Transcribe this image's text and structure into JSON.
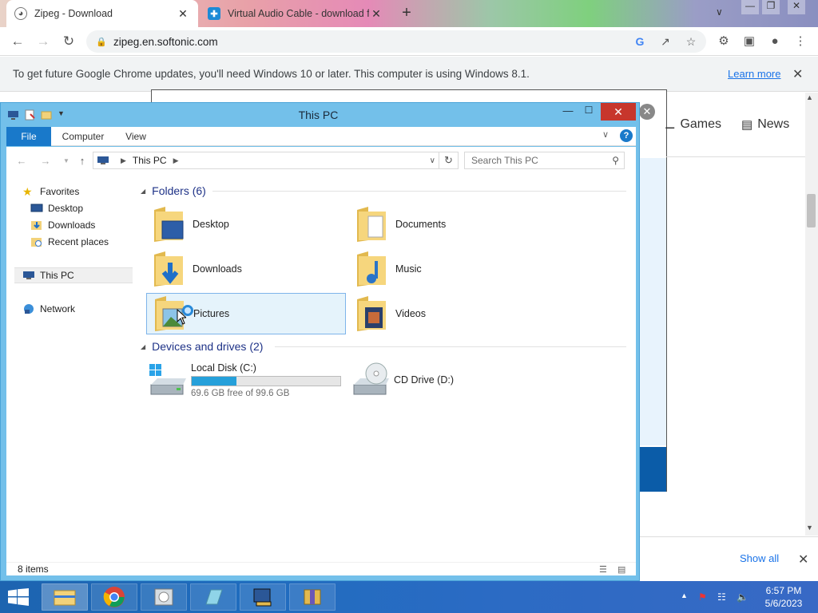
{
  "browser": {
    "tabs": [
      {
        "title": "Zipeg - Download",
        "favicon": "softonic-icon",
        "active": true
      },
      {
        "title": "Virtual Audio Cable - download f",
        "favicon": "vac-icon",
        "active": false
      }
    ],
    "new_tab": "+",
    "url": "zipeg.en.softonic.com",
    "infobar": {
      "message": "To get future Google Chrome updates, you'll need Windows 10 or later. This computer is using Windows 8.1.",
      "learn_more": "Learn more"
    }
  },
  "page": {
    "nav_games": "Games",
    "nav_news": "News",
    "show_all": "Show all"
  },
  "explorer": {
    "title": "This PC",
    "ribbon_tabs": [
      "File",
      "Computer",
      "View"
    ],
    "address": {
      "location": "This PC"
    },
    "search_placeholder": "Search This PC",
    "nav": {
      "favorites": "Favorites",
      "desktop": "Desktop",
      "downloads": "Downloads",
      "recent": "Recent places",
      "this_pc": "This PC",
      "network": "Network"
    },
    "folders_header": "Folders (6)",
    "folders": [
      {
        "name": "Desktop",
        "icon": "desktop-folder-icon"
      },
      {
        "name": "Documents",
        "icon": "documents-folder-icon"
      },
      {
        "name": "Downloads",
        "icon": "downloads-folder-icon"
      },
      {
        "name": "Music",
        "icon": "music-folder-icon"
      },
      {
        "name": "Pictures",
        "icon": "pictures-folder-icon",
        "selected": true
      },
      {
        "name": "Videos",
        "icon": "videos-folder-icon"
      }
    ],
    "devices_header": "Devices and drives (2)",
    "drives": [
      {
        "name": "Local Disk (C:)",
        "free": "69.6 GB free of 99.6 GB",
        "used_fraction": 0.3
      },
      {
        "name": "CD Drive (D:)"
      }
    ],
    "status": "8 items"
  },
  "taskbar": {
    "time": "6:57 PM",
    "date": "5/6/2023"
  }
}
